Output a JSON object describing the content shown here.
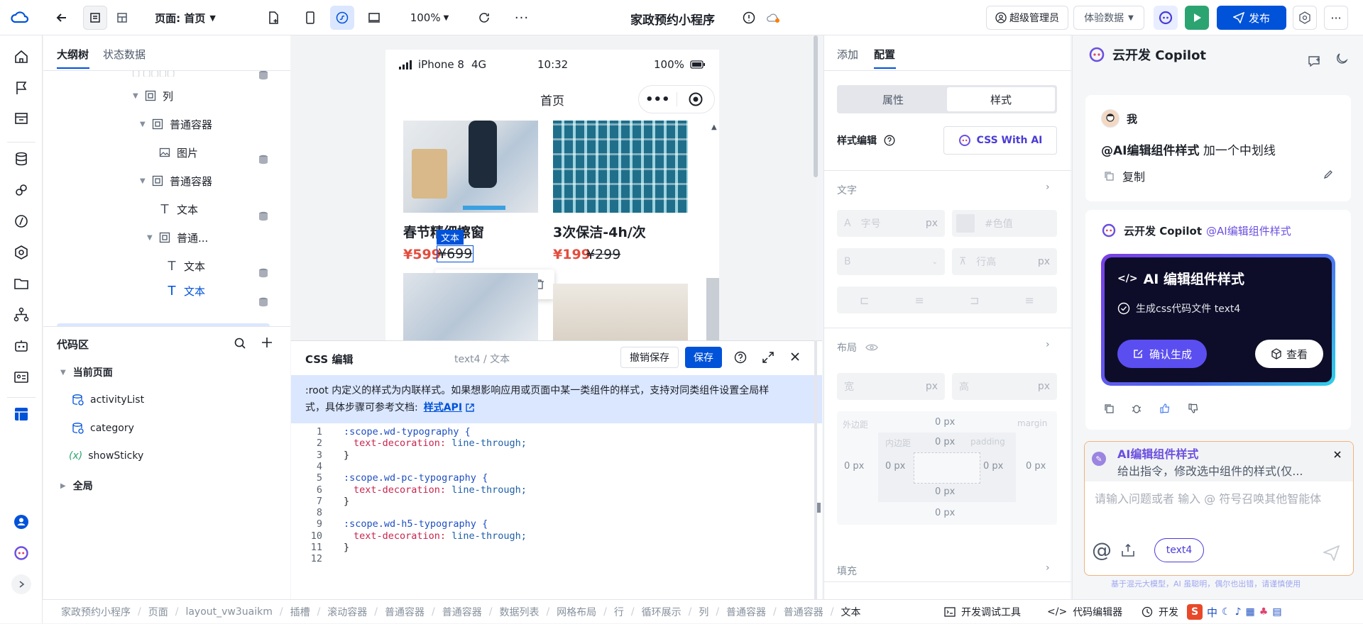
{
  "topbar": {
    "page_label": "页面: 首页",
    "zoom": "100%",
    "app_title": "家政预约小程序",
    "admin": "超级管理员",
    "data_mode": "体验数据",
    "publish": "发布"
  },
  "outline": {
    "tabs": [
      "大纲树",
      "状态数据"
    ],
    "nodes": [
      {
        "label": "列"
      },
      {
        "label": "普通容器"
      },
      {
        "label": "图片"
      },
      {
        "label": "普通容器"
      },
      {
        "label": "文本"
      },
      {
        "label": "普通..."
      },
      {
        "label": "文本"
      },
      {
        "label": "文本"
      }
    ]
  },
  "code_area": {
    "title": "代码区",
    "current_page": "当前页面",
    "items": [
      "activityList",
      "category",
      "showSticky"
    ],
    "global": "全局"
  },
  "phone": {
    "device": "iPhone 8",
    "network": "4G",
    "time": "10:32",
    "battery": "100%",
    "page_title": "首页",
    "products": [
      {
        "name": "春节精细擦窗",
        "price": "¥599",
        "old_price": "¥699"
      },
      {
        "name": "3次保洁-4h/次",
        "price": "¥199",
        "old_price": "¥299"
      }
    ],
    "selected_tag": "文本"
  },
  "css_editor": {
    "title": "CSS 编辑",
    "path": "text4 / 文本",
    "undo": "撤销保存",
    "save": "保存",
    "notice_1": ":root 内定义的样式为内联样式。如果想影响应用或页面中某一类组件的样式，支持对同类组件设置全局样",
    "notice_2": "式，具体步骤可参考文档:",
    "notice_link": "样式API",
    "lines": [
      {
        "n": "1",
        "t": "sel",
        "text": ":scope.wd-typography {"
      },
      {
        "n": "2",
        "t": "decl",
        "prop": "text-decoration:",
        "val": " line-through;"
      },
      {
        "n": "3",
        "t": "plain",
        "text": "}"
      },
      {
        "n": "4",
        "t": "plain",
        "text": ""
      },
      {
        "n": "5",
        "t": "sel",
        "text": ":scope.wd-pc-typography {"
      },
      {
        "n": "6",
        "t": "decl",
        "prop": "text-decoration:",
        "val": " line-through;"
      },
      {
        "n": "7",
        "t": "plain",
        "text": "}"
      },
      {
        "n": "8",
        "t": "plain",
        "text": ""
      },
      {
        "n": "9",
        "t": "sel",
        "text": ":scope.wd-h5-typography {"
      },
      {
        "n": "10",
        "t": "decl",
        "prop": "text-decoration:",
        "val": " line-through;"
      },
      {
        "n": "11",
        "t": "plain",
        "text": "}"
      },
      {
        "n": "12",
        "t": "plain",
        "text": ""
      }
    ]
  },
  "props": {
    "tabs": [
      "添加",
      "配置"
    ],
    "seg": [
      "属性",
      "样式"
    ],
    "style_edit": "样式编辑",
    "css_ai": "CSS With AI",
    "text_section": "文字",
    "font_size_ph": "字号",
    "color_ph": "#色值",
    "line_height_ph": "行高",
    "unit": "px",
    "layout_section": "布局",
    "width_label": "宽",
    "height_label": "高",
    "margin_label": "外边距",
    "margin_en": "margin",
    "padding_label": "内边距",
    "padding_en": "padding",
    "zero": "0 px",
    "fill_section": "填充"
  },
  "copilot": {
    "title": "云开发 Copilot",
    "me": "我",
    "user_msg_tag": "@AI编辑组件样式",
    "user_msg": " 加一个中划线",
    "copy": "复制",
    "bot_name": "云开发 Copilot",
    "bot_tag": "@AI编辑组件样式",
    "card_title": "AI 编辑组件样式",
    "card_sub": "生成css代码文件 text4",
    "confirm": "确认生成",
    "view": "查看",
    "agent_name": "AI编辑组件样式",
    "agent_desc": "给出指令，修改选中组件的样式(仅...",
    "input_ph": "请输入问题或者 输入 @ 符号召唤其他智能体",
    "chip": "text4",
    "disclaimer": "基于混元大模型，AI 虽聪明，偶尔也出错，请谨慎使用"
  },
  "breadcrumb": [
    "家政预约小程序",
    "页面",
    "layout_vw3uaikm",
    "插槽",
    "滚动容器",
    "普通容器",
    "普通容器",
    "数据列表",
    "网格布局",
    "行",
    "循环展示",
    "列",
    "普通容器",
    "普通容器",
    "文本"
  ],
  "bottom_tools": [
    "开发调试工具",
    "代码编辑器",
    "开发"
  ],
  "colors": {
    "primary": "#0052d9",
    "green": "#2ba471",
    "price": "#e34d3d",
    "select": "#dbe7ff"
  }
}
